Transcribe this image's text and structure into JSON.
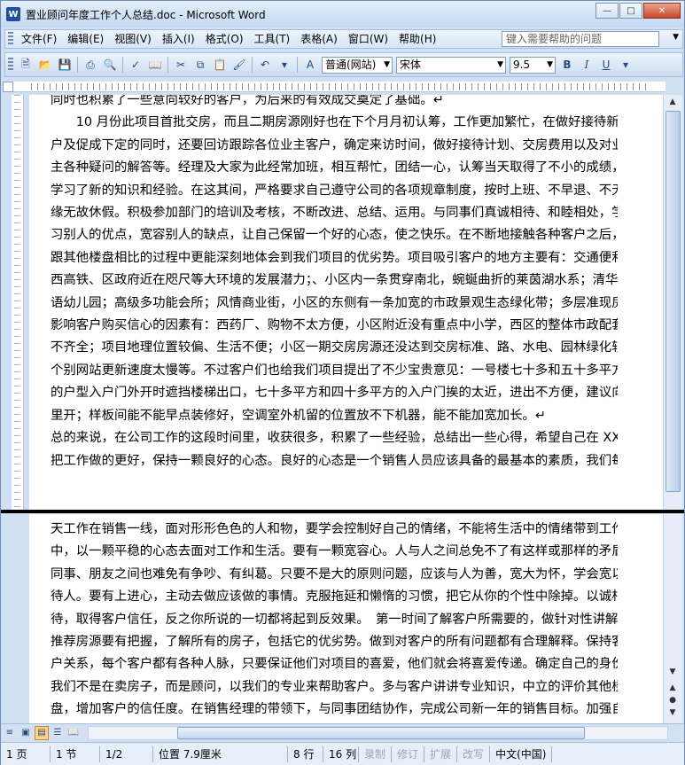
{
  "window": {
    "title": "置业顾问年度工作个人总结.doc - Microsoft Word",
    "app_icon": "W",
    "buttons": [
      "minimize",
      "maximize",
      "close"
    ]
  },
  "menu": {
    "items": [
      "文件(F)",
      "编辑(E)",
      "视图(V)",
      "插入(I)",
      "格式(O)",
      "工具(T)",
      "表格(A)",
      "窗口(W)",
      "帮助(H)"
    ],
    "help_placeholder": "键入需要帮助的问题"
  },
  "toolbar": {
    "style": "普通(网站)",
    "font": "宋体",
    "size": "9.5",
    "bold": "B",
    "italic": "I",
    "underline": "U"
  },
  "document": {
    "top_lines": [
      "同时也积累了一些意向较好的客户，为后来的有效成交奠定了基础。↵",
      "",
      "　　10 月份此项目首批交房，而且二期房源刚好也在下个月月初认筹，工作更加繁忙，在做好接待新客",
      "户及促成下定的同时，还要回访跟踪各位业主客户，确定来访时间，做好接待计划、交房费用以及对业",
      "主各种疑问的解答等。经理及大家为此经常加班，相互帮忙，团结一心，认筹当天取得了不小的成绩，",
      "学习了新的知识和经验。在这其间，严格要求自己遵守公司的各项规章制度，按时上班、不早退、不无",
      "缘无故休假。积极参加部门的培训及考核，不断改进、总结、运用。与同事们真诚相待、和睦相处，学",
      "习别人的优点，宽容别人的缺点，让自己保留一个好的心态，使之快乐。在不断地接触各种客户之后，",
      "跟其他楼盘相比的过程中更能深刻地体会到我们项目的优劣势。项目吸引客户的地方主要有：交通便利、",
      "西高铁、区政府近在咫尺等大环境的发展潜力；、小区内一条贯穿南北，蜿蜒曲折的莱茵湖水系；清华双",
      "语幼儿园；高级多功能会所；风情商业街，小区的东侧有一条加宽的市政景观生态绿化带；多层准现房，而",
      "影响客户购买信心的因素有：西药厂、购物不太方便，小区附近没有重点中小学，西区的整体市政配套",
      "不齐全；项目地理位置较偏、生活不便；小区一期交房房源还没达到交房标准、路、水电、园林绿化较慢、",
      "个别网站更新速度太慢等。不过客户们也给我们项目提出了不少宝贵意见：一号楼七十多和五十多平方",
      "的户型入户门外开时遮挡楼梯出口，七十多平方和四十多平方的入户门挨的太近，进出不方便，建议向",
      "里开；样板间能不能早点装修好，空调室外机留的位置放不下机器，能不能加宽加长。↵",
      "",
      "总的来说，在公司工作的这段时间里，收获很多，积累了一些经验，总结出一些心得，希望自己在 XX 年",
      "把工作做的更好，保持一颗良好的心态。良好的心态是一个销售人员应该具备的最基本的素质，我们每"
    ],
    "bottom_lines": [
      "天工作在销售一线，面对形形色色的人和物，要学会控制好自己的情绪，不能将生活中的情绪带到工作",
      "中，以一颗平稳的心态去面对工作和生活。要有一颗宽容心。人与人之间总免不了有这样或那样的矛盾，",
      "同事、朋友之间也难免有争吵、有纠葛。只要不是大的原则问题，应该与人为善，宽大为怀，学会宽以",
      "待人。要有上进心，主动去做应该做的事情。克服拖延和懒惰的习惯，把它从你的个性中除掉。以诚相",
      "待，取得客户信任，反之你所说的一切都将起到反效果。　第一时间了解客户所需要的，做针对性讲解。",
      "推荐房源要有把握，了解所有的房子，包括它的优劣势。做到对客户的所有问题都有合理解释。保持客",
      "户关系，每个客户都有各种人脉，只要保证他们对项目的喜爱，他们就会将喜爱传递。确定自己的身份，",
      "我们不是在卖房子，而是顾问，以我们的专业来帮助客户。多与客户讲讲专业知识，中立的评价其他楼",
      "盘，增加客户的信任度。在销售经理的带领下，与同事团结协作，完成公司新一年的销售目标。加强自"
    ]
  },
  "status": {
    "page": "1 页",
    "section": "1 节",
    "pages": "1/2",
    "position": "位置 7.9厘米",
    "line": "8 行",
    "column": "16 列",
    "rec": "录制",
    "trk": "修订",
    "ext": "扩展",
    "ovr": "改写",
    "language": "中文(中国)"
  },
  "colors": {
    "chrome": "#cfe0f3",
    "accent": "#1f4f9e"
  }
}
